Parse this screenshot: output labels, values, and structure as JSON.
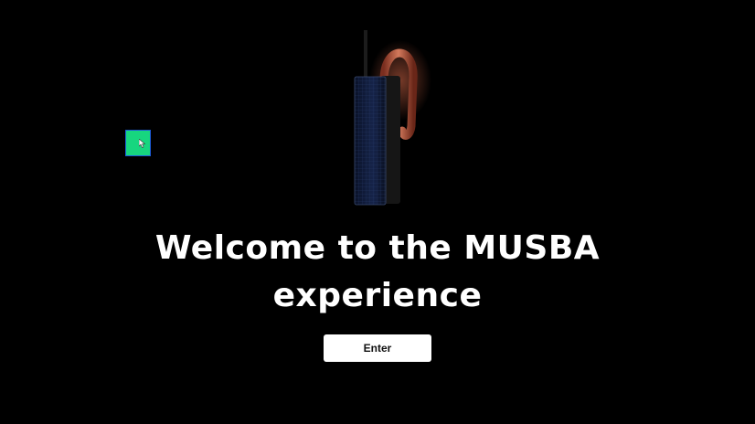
{
  "welcome": {
    "title_line1": "Welcome to the MUSBA",
    "title_line2": "experience"
  },
  "enter_button": {
    "label": "Enter"
  },
  "colors": {
    "background": "#000000",
    "text": "#ffffff",
    "button_bg": "#ffffff",
    "widget_green": "#17d67f",
    "widget_border": "#1d5bd8",
    "sculpture_copper": "#b4553a",
    "sculpture_panel": "#0f1a33"
  },
  "icons": {
    "artwork": "sculpture-3d-model",
    "widget": "cursor-pointer-icon"
  }
}
